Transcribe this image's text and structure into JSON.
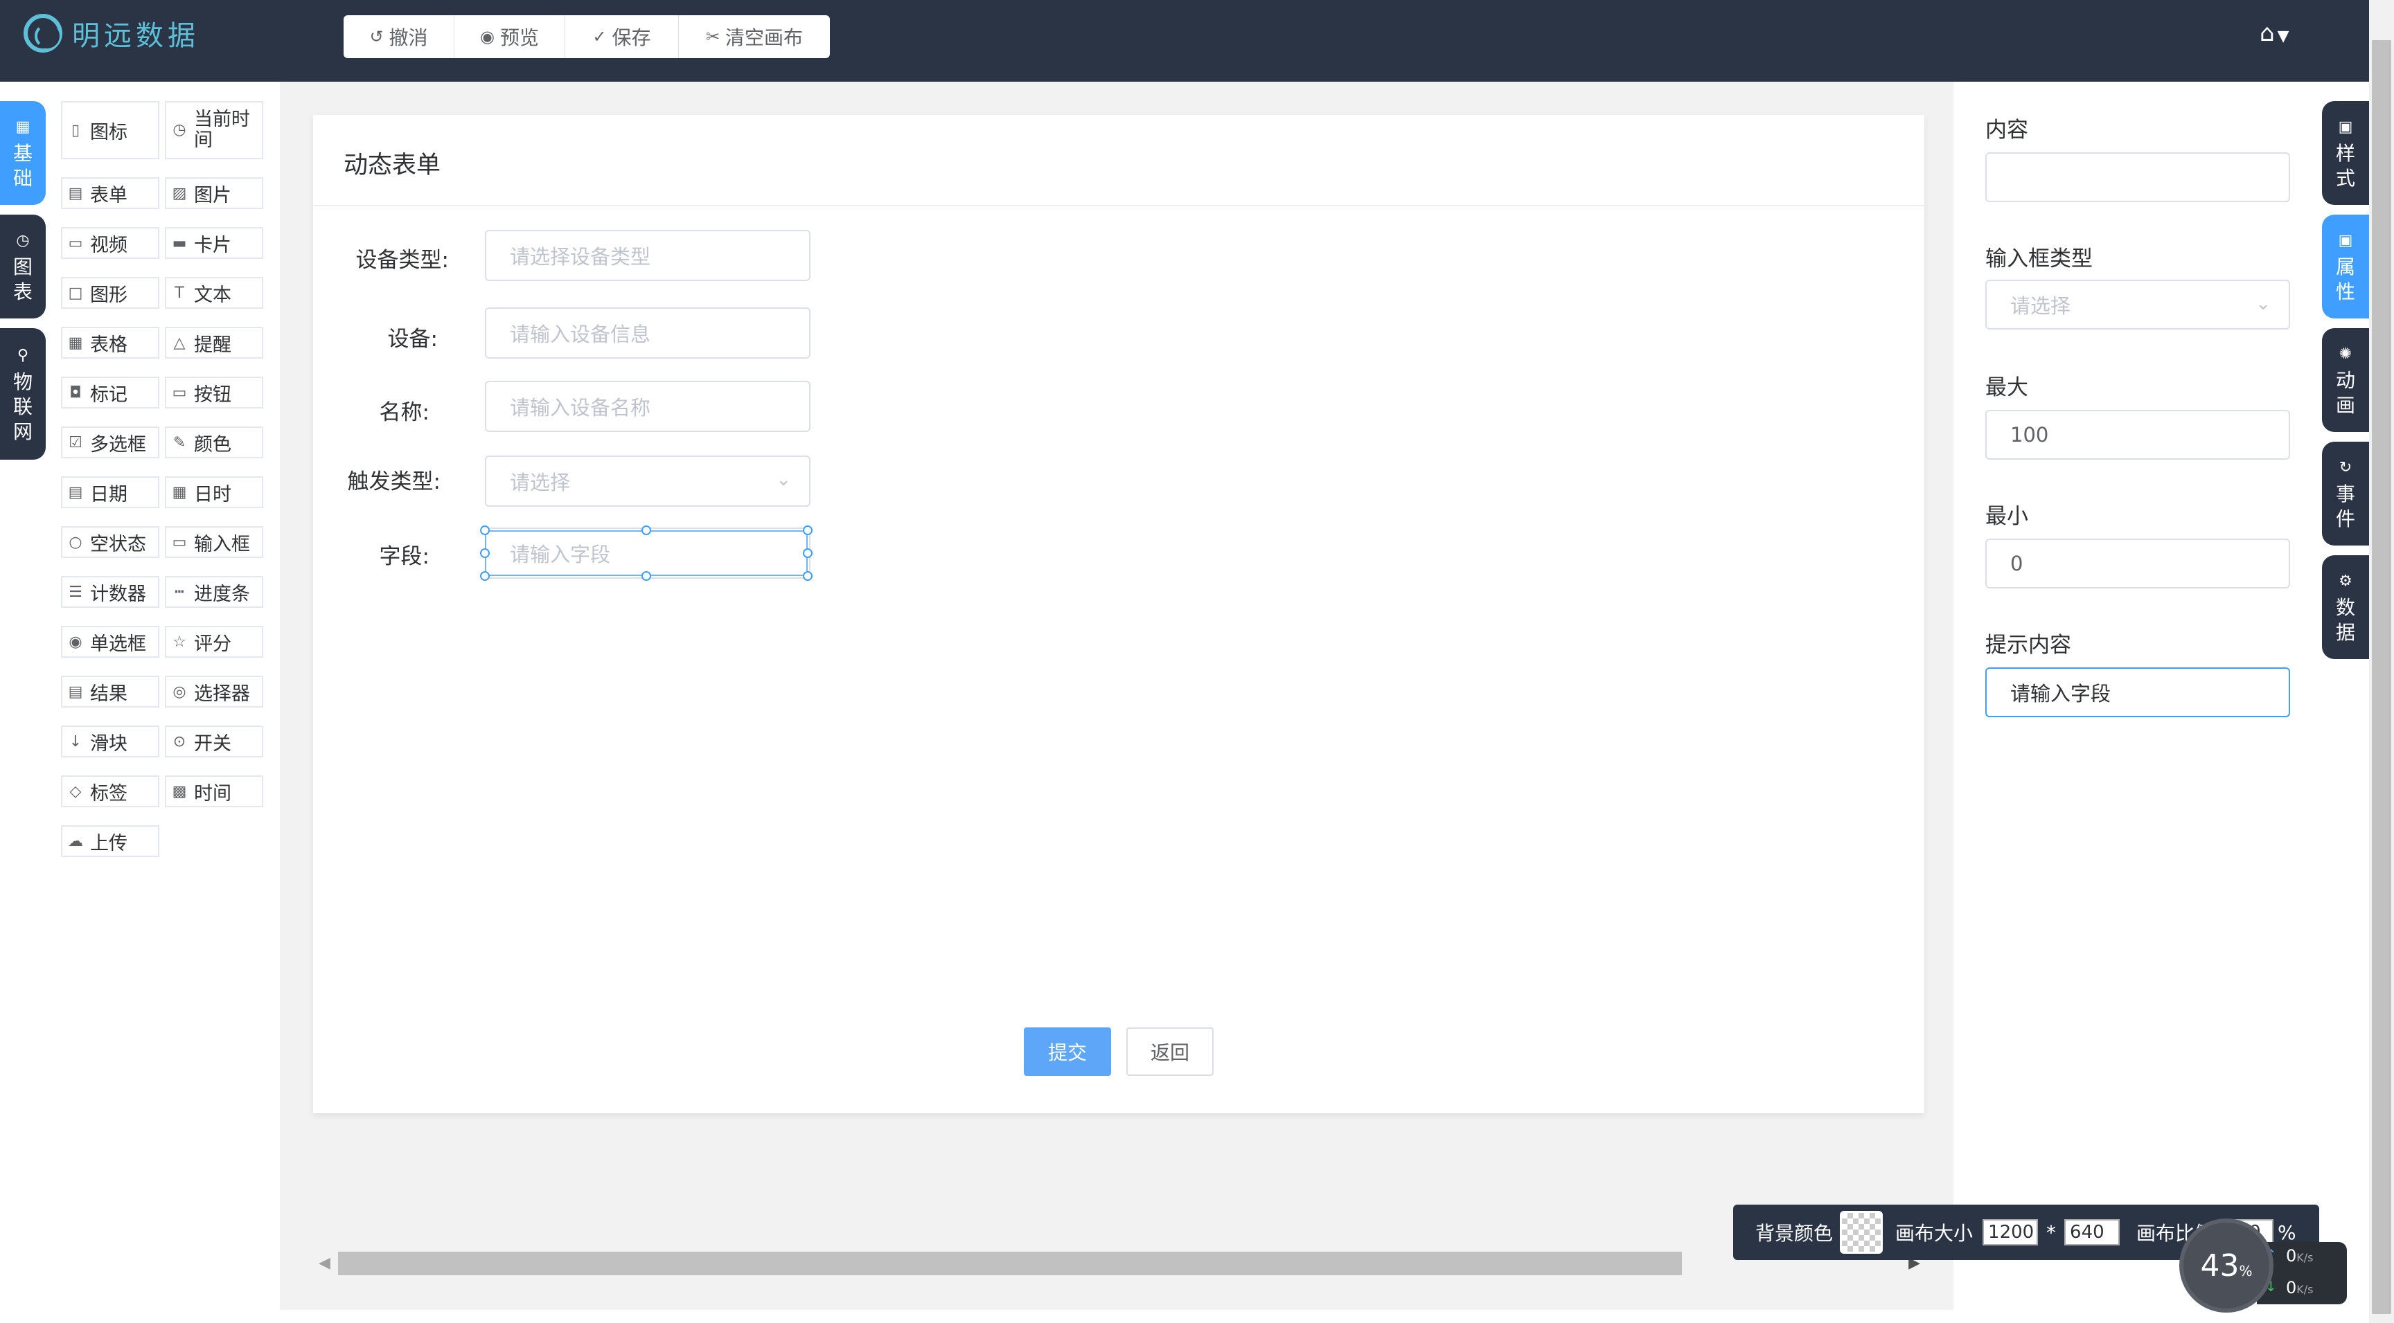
{
  "app": {
    "logo_text": "明远数据"
  },
  "toolbar": [
    {
      "icon": "undo-icon",
      "glyph": "↺",
      "label": "撤消"
    },
    {
      "icon": "eye-icon",
      "glyph": "◉",
      "label": "预览"
    },
    {
      "icon": "save-icon",
      "glyph": "✓",
      "label": "保存"
    },
    {
      "icon": "scissors-icon",
      "glyph": "✂",
      "label": "清空画布"
    }
  ],
  "left_tabs": [
    {
      "label": "基础",
      "chars": [
        "基",
        "础"
      ],
      "icon": "grid-icon",
      "glyph": "▦",
      "active": true
    },
    {
      "label": "图表",
      "chars": [
        "图",
        "表"
      ],
      "icon": "pie-chart-icon",
      "glyph": "◷",
      "active": false
    },
    {
      "label": "物联网",
      "chars": [
        "物",
        "联",
        "网"
      ],
      "icon": "iot-icon",
      "glyph": "⚲",
      "active": false
    }
  ],
  "components": [
    {
      "label": "图标",
      "icon": "pin-icon",
      "glyph": "▯"
    },
    {
      "label": "当前时间",
      "icon": "clock-icon",
      "glyph": "◷"
    },
    {
      "label": "表单",
      "icon": "form-icon",
      "glyph": "▤"
    },
    {
      "label": "图片",
      "icon": "image-icon",
      "glyph": "▨"
    },
    {
      "label": "视频",
      "icon": "video-icon",
      "glyph": "▭"
    },
    {
      "label": "卡片",
      "icon": "card-icon",
      "glyph": "▬"
    },
    {
      "label": "图形",
      "icon": "shape-icon",
      "glyph": "□"
    },
    {
      "label": "文本",
      "icon": "text-icon",
      "glyph": "T"
    },
    {
      "label": "表格",
      "icon": "table-icon",
      "glyph": "▦"
    },
    {
      "label": "提醒",
      "icon": "warning-icon",
      "glyph": "△"
    },
    {
      "label": "标记",
      "icon": "marker-icon",
      "glyph": "◘"
    },
    {
      "label": "按钮",
      "icon": "button-icon",
      "glyph": "▭"
    },
    {
      "label": "多选框",
      "icon": "checkbox-icon",
      "glyph": "☑"
    },
    {
      "label": "颜色",
      "icon": "brush-icon",
      "glyph": "✎"
    },
    {
      "label": "日期",
      "icon": "date-icon",
      "glyph": "▤"
    },
    {
      "label": "日时",
      "icon": "calendar-icon",
      "glyph": "▦"
    },
    {
      "label": "空状态",
      "icon": "empty-icon",
      "glyph": "○"
    },
    {
      "label": "输入框",
      "icon": "input-icon",
      "glyph": "▭"
    },
    {
      "label": "计数器",
      "icon": "counter-icon",
      "glyph": "☰"
    },
    {
      "label": "进度条",
      "icon": "progress-icon",
      "glyph": "┅"
    },
    {
      "label": "单选框",
      "icon": "radio-icon",
      "glyph": "◉"
    },
    {
      "label": "评分",
      "icon": "star-icon",
      "glyph": "☆"
    },
    {
      "label": "结果",
      "icon": "result-icon",
      "glyph": "▤"
    },
    {
      "label": "选择器",
      "icon": "select-icon",
      "glyph": "◎"
    },
    {
      "label": "滑块",
      "icon": "slider-icon",
      "glyph": "↓"
    },
    {
      "label": "开关",
      "icon": "switch-icon",
      "glyph": "⊙"
    },
    {
      "label": "标签",
      "icon": "tag-icon",
      "glyph": "◇"
    },
    {
      "label": "时间",
      "icon": "time-icon",
      "glyph": "▩"
    },
    {
      "label": "上传",
      "icon": "upload-icon",
      "glyph": "☁"
    }
  ],
  "form": {
    "title": "动态表单",
    "fields": [
      {
        "label": "设备类型:",
        "placeholder": "请选择设备类型",
        "type": "input"
      },
      {
        "label": "设备:",
        "placeholder": "请输入设备信息",
        "type": "input"
      },
      {
        "label": "名称:",
        "placeholder": "请输入设备名称",
        "type": "input"
      },
      {
        "label": "触发类型:",
        "placeholder": "请选择",
        "type": "select"
      },
      {
        "label": "字段:",
        "placeholder": "请输入字段",
        "type": "input",
        "selected": true
      }
    ],
    "submit_label": "提交",
    "back_label": "返回"
  },
  "properties": {
    "content_label": "内容",
    "content_value": "",
    "input_type_label": "输入框类型",
    "input_type_placeholder": "请选择",
    "max_label": "最大",
    "max_value": "100",
    "min_label": "最小",
    "min_value": "0",
    "hint_label": "提示内容",
    "hint_value": "请输入字段"
  },
  "right_tabs": [
    {
      "label": "样式",
      "chars": [
        "样",
        "式"
      ],
      "icon": "style-icon",
      "glyph": "▣",
      "active": false
    },
    {
      "label": "属性",
      "chars": [
        "属",
        "性"
      ],
      "icon": "property-icon",
      "glyph": "▣",
      "active": true
    },
    {
      "label": "动画",
      "chars": [
        "动",
        "画"
      ],
      "icon": "animation-icon",
      "glyph": "✺",
      "active": false
    },
    {
      "label": "事件",
      "chars": [
        "事",
        "件"
      ],
      "icon": "event-icon",
      "glyph": "↻",
      "active": false
    },
    {
      "label": "数据",
      "chars": [
        "数",
        "据"
      ],
      "icon": "data-icon",
      "glyph": "⚙",
      "active": false
    }
  ],
  "status_bar": {
    "bg_color_label": "背景颜色",
    "canvas_size_label": "画布大小",
    "width": "1200",
    "separator": "*",
    "height": "640",
    "ratio_label": "画布比例",
    "ratio_value": "100",
    "ratio_unit": "%"
  },
  "net_monitor": {
    "percent": "43",
    "percent_unit": "%",
    "up": "0",
    "down": "0",
    "unit": "K/s"
  }
}
